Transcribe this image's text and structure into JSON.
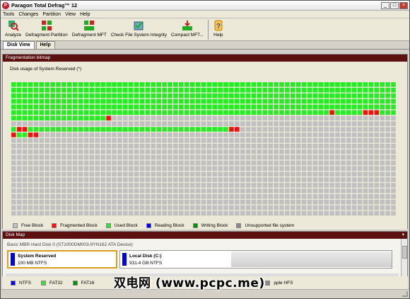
{
  "window": {
    "title": "Paragon Total Defrag™ 12"
  },
  "menu": [
    "Tools",
    "Changes",
    "Partition",
    "View",
    "Help"
  ],
  "toolbar": [
    {
      "label": "Analyze",
      "icon": "analyze-icon"
    },
    {
      "label": "Defragment Partition",
      "icon": "defragment-partition-icon"
    },
    {
      "label": "Defragment MFT",
      "icon": "defragment-mft-icon"
    },
    {
      "label": "Check File System Integrity",
      "icon": "check-file-system-icon"
    },
    {
      "label": "Compact MFT...",
      "icon": "compact-mft-icon"
    },
    {
      "label": "Help",
      "icon": "help-icon"
    }
  ],
  "tabs": [
    "Disk View",
    "Help"
  ],
  "fragmentation": {
    "header": "Fragmentation bitmap",
    "usage_label": "Disk usage of System Reserved (*)"
  },
  "bitmap": {
    "columns": 69,
    "rows": 24,
    "colors": {
      "free": "#c0c0c0",
      "fragmented": "#ee1111",
      "used": "#22ee22",
      "reading": "#0000ee",
      "writing": "#118811",
      "unsupported": "#888888"
    },
    "row_patterns": [
      "GGGGGGGGGGGGGGGGGGGGGGGGGGGGGGGGGGGGGGGGGGGGGGGGGGGGGGGGGGGGGGGGGGGGG",
      "GGGGGGGGGGGGGGGGGGGGGGGGGGGGGGGGGGGGGGGGGGGGGGGGGGGGGGGGGGGGGGGGGGGGG",
      "GGGGGGGGGGGGGGGGGGGGGGGGGGGGGGGGGGGGGGGGGGGGGGGGGGGGGGGGGGGGGGGGGGGGG",
      "GGGGGGGGGGGGGGGGGGGGGGGGGGGGGGGGGGGGGGGGGGGGGGGGGGGGGGGGGGGGGGGGGGGGG",
      "GGGGGGGGGGGGGGGGGGGGGGGGGGGGGGGGGGGGGGGGGGGGGGGGGGGGGGGGGGGGGGGGGGGGG",
      "GGGGGGGGGGGGGGGGGGGGGGGGGGGGGGGGGGGGGGGGGGGGGGGGGGGGGGGGGRGGGGGRRRGGG",
      "GGGGGGGGGGGGGGGGGRFFFFFFFFFFFFFFFFFFFFFFFFFFFFFFFFFFFFFFFFFFFFFFFFFFF",
      "FFFFFFFFFFFFFFFFFFFFFFFFFFFFFFFFFFFFFFFFFFFFFFFFFFFFFFFFFFFFFFFFFFFFF",
      "GRRGGGGGGGGGGGGGGGGGGGGGGGGGGGGGGGGGGGGRRFFFFFFFFFFFFFFFFFFFFFFFFFFFF",
      "RGGRRFFFFFFFFFFFFFFFFFFFFFFFFFFFFFFFFFFFFFFFFFFFFFFFFFFFFFFFFFFFFFFFF"
    ]
  },
  "legend": [
    {
      "label": "Free Block",
      "color": "#c0c0c0"
    },
    {
      "label": "Fragmented Block",
      "color": "#ee1111"
    },
    {
      "label": "Used Block",
      "color": "#22ee22"
    },
    {
      "label": "Reading Block",
      "color": "#0000ee"
    },
    {
      "label": "Writing Block",
      "color": "#118811"
    },
    {
      "label": "Unsupported file system",
      "color": "#888888"
    }
  ],
  "diskmap": {
    "header": "Disk Map",
    "disk_title": "Basic MBR Hard Disk 0 (ST1000DM003-9YN162 ATA Device)",
    "partitions": [
      {
        "name": "System Reserved",
        "size": "100 MB NTFS"
      },
      {
        "name": "Local Disk (C:)",
        "size": "931.4 GB NTFS"
      }
    ]
  },
  "fs_legend": [
    {
      "label": "NTFS",
      "color": "#0000ee"
    },
    {
      "label": "FAT32",
      "color": "#22ee22"
    },
    {
      "label": "FAT16",
      "color": "#118811"
    },
    {
      "label": "pple HFS",
      "color": "#888888"
    }
  ],
  "watermark": "双电网 (www.pcpc.me)"
}
